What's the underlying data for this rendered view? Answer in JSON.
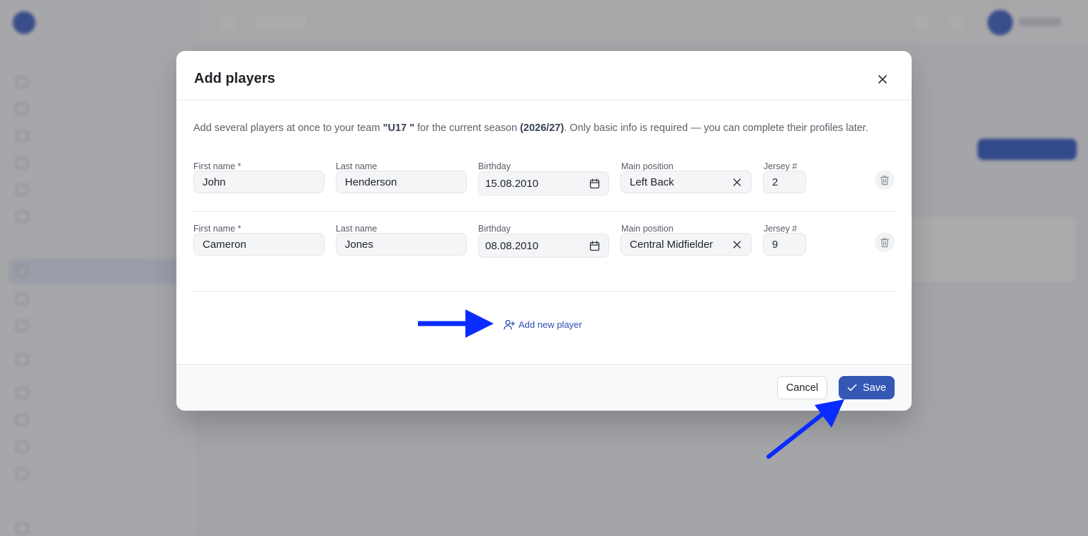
{
  "colors": {
    "accent": "#3558b5",
    "link": "#2f4fb5",
    "annotation_arrow": "#0a2bff",
    "input_bg": "#f4f5f7",
    "overlay": "rgba(55,55,60,0.42)"
  },
  "modal": {
    "title": "Add players",
    "close_icon": "close-icon",
    "intro": {
      "part1": "Add several players at once to your team ",
      "team": "\"U17 \"",
      "part2": " for the current season ",
      "season": "(2026/27)",
      "part3": ". Only basic info is required — you can complete their profiles later."
    },
    "labels": {
      "first_name": "First name *",
      "last_name": "Last name",
      "birthday": "Birthday",
      "main_position": "Main position",
      "jersey": "Jersey #"
    },
    "players": [
      {
        "first_name": "John",
        "last_name": "Henderson",
        "birthday": "15.08.2010",
        "main_position": "Left Back",
        "jersey": "2"
      },
      {
        "first_name": "Cameron",
        "last_name": "Jones",
        "birthday": "08.08.2010",
        "main_position": "Central Midfielder",
        "jersey": "9"
      }
    ],
    "add_new_player_label": "Add new player",
    "add_icon": "user-plus-icon",
    "cancel_label": "Cancel",
    "save_label": "Save",
    "save_icon": "check-icon"
  }
}
